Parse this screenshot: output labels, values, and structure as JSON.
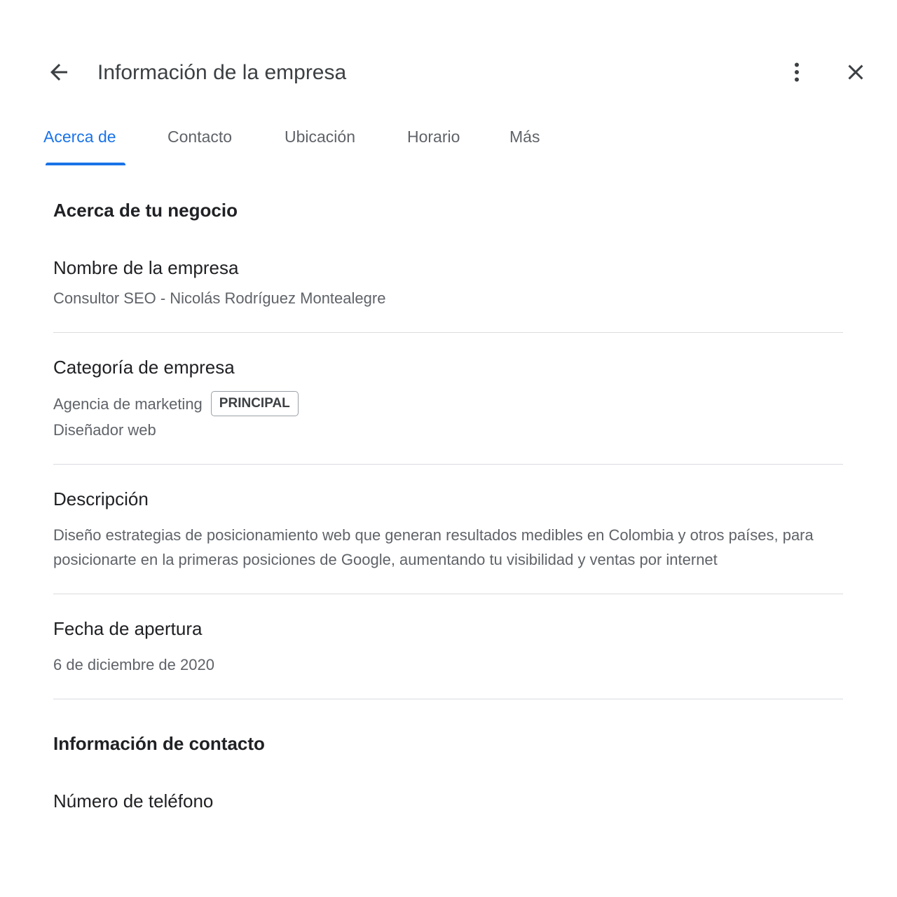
{
  "header": {
    "title": "Información de la empresa",
    "back_icon": "arrow-back-icon",
    "more_icon": "more-vert-icon",
    "close_icon": "close-icon"
  },
  "tabs": [
    {
      "label": "Acerca de",
      "active": true
    },
    {
      "label": "Contacto",
      "active": false
    },
    {
      "label": "Ubicación",
      "active": false
    },
    {
      "label": "Horario",
      "active": false
    },
    {
      "label": "Más",
      "active": false
    }
  ],
  "about": {
    "section_title": "Acerca de tu negocio",
    "business_name": {
      "label": "Nombre de la empresa",
      "value": "Consultor SEO - Nicolás Rodríguez Montealegre"
    },
    "category": {
      "label": "Categoría de empresa",
      "primary": "Agencia de marketing",
      "primary_badge": "PRINCIPAL",
      "additional": "Diseñador web"
    },
    "description": {
      "label": "Descripción",
      "value": "Diseño estrategias de posicionamiento web que generan resultados medibles en Colombia y otros países, para posicionarte en la primeras posiciones de Google, aumentando tu visibilidad y ventas por internet"
    },
    "opening_date": {
      "label": "Fecha de apertura",
      "value": "6 de diciembre de 2020"
    }
  },
  "contact": {
    "section_title": "Información de contacto",
    "phone": {
      "label": "Número de teléfono"
    }
  },
  "colors": {
    "accent": "#1a73e8",
    "text_primary": "#202124",
    "text_secondary": "#5f6368",
    "divider": "#dadce0"
  }
}
